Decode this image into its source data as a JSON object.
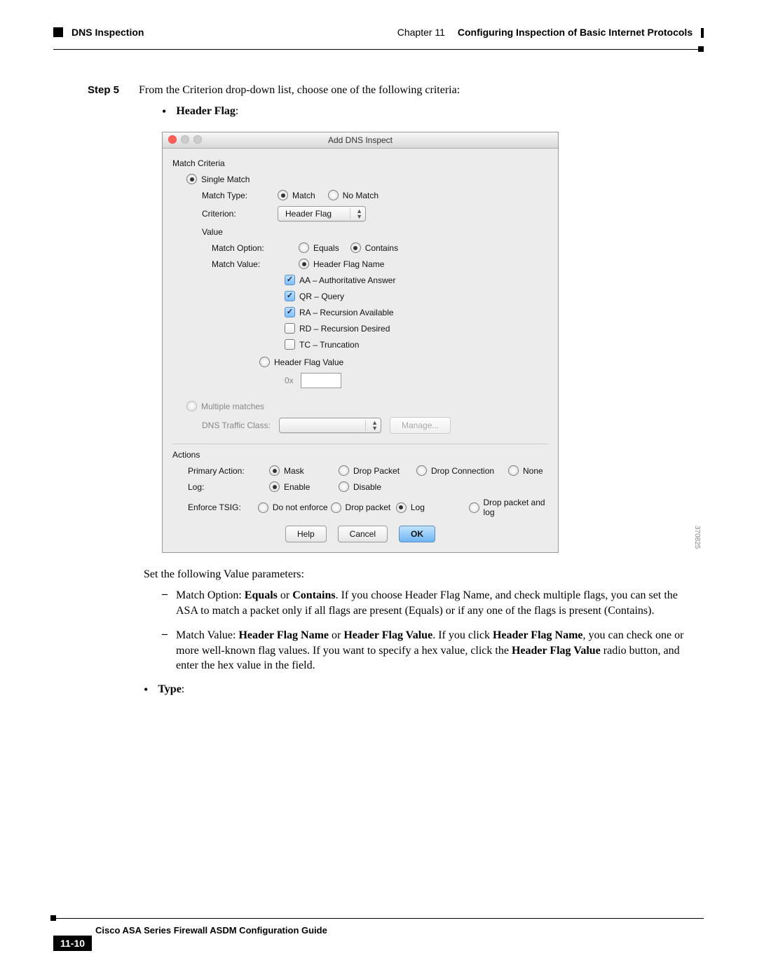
{
  "header": {
    "section": "DNS Inspection",
    "chapter": "Chapter 11",
    "title": "Configuring Inspection of Basic Internet Protocols"
  },
  "step": {
    "label": "Step 5",
    "text": "From the Criterion drop-down list, choose one of the following criteria:"
  },
  "bullet_header_flag": "Header Flag",
  "dialog": {
    "title": "Add DNS Inspect",
    "match_criteria": "Match Criteria",
    "single_match": "Single Match",
    "match_type_label": "Match Type:",
    "match": "Match",
    "no_match": "No Match",
    "criterion_label": "Criterion:",
    "criterion_value": "Header Flag",
    "value_label": "Value",
    "match_option_label": "Match Option:",
    "equals": "Equals",
    "contains": "Contains",
    "match_value_label": "Match Value:",
    "header_flag_name": "Header Flag Name",
    "flags": [
      {
        "code": "AA",
        "desc": "Authoritative Answer",
        "checked": true
      },
      {
        "code": "QR",
        "desc": "Query",
        "checked": true
      },
      {
        "code": "RA",
        "desc": "Recursion Available",
        "checked": true
      },
      {
        "code": "RD",
        "desc": "Recursion Desired",
        "checked": false
      },
      {
        "code": "TC",
        "desc": "Truncation",
        "checked": false
      }
    ],
    "header_flag_value": "Header Flag Value",
    "hex_prefix": "0x",
    "multiple_matches": "Multiple matches",
    "dns_traffic_class": "DNS Traffic Class:",
    "manage": "Manage...",
    "actions": "Actions",
    "primary_action_label": "Primary Action:",
    "mask": "Mask",
    "drop_packet": "Drop Packet",
    "drop_connection": "Drop Connection",
    "none": "None",
    "log_label": "Log:",
    "enable": "Enable",
    "disable": "Disable",
    "enforce_tsig_label": "Enforce TSIG:",
    "do_not_enforce": "Do not enforce",
    "drop_packet2": "Drop packet",
    "log": "Log",
    "drop_and_log": "Drop packet and log",
    "help": "Help",
    "cancel": "Cancel",
    "ok": "OK",
    "img_id": "370825"
  },
  "after_intro": "Set the following Value parameters:",
  "dash_items": [
    "Match Option: <b>Equals</b> or <b>Contains</b>. If you choose Header Flag Name, and check multiple flags, you can set the ASA to match a packet only if all flags are present (Equals) or if any one of the flags is present (Contains).",
    "Match Value: <b>Header Flag Name</b> or <b>Header Flag Value</b>. If you click <b>Header Flag Name</b>, you can check one or more well-known flag values. If you want to specify a hex value, click the <b>Header Flag Value</b> radio button, and enter the hex value in the field."
  ],
  "bullet_type": "Type",
  "footer": {
    "book": "Cisco ASA Series Firewall ASDM Configuration Guide",
    "page": "11-10"
  }
}
